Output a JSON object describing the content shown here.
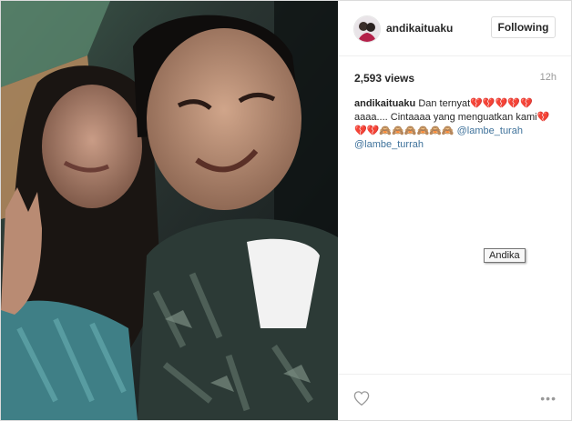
{
  "post": {
    "username": "andikaituaku",
    "follow_label": "Following",
    "views": "2,593 views",
    "time": "12h",
    "caption": {
      "username": "andikaituaku",
      "line1": "Dan ternyat💔💔💔💔💔",
      "line2": "aaaa.... Cintaaaa yang menguatkan kami💔",
      "line3_emoji": "💔💔🙈🙈🙈🙈🙈🙈",
      "mention1": "@lambe_turah",
      "mention2": "@lambe_turrah"
    },
    "tooltip": "Andika",
    "more_label": "•••"
  },
  "icons": {
    "like": "heart-icon",
    "options": "more-options-icon",
    "avatar": "avatar"
  },
  "colors": {
    "mention": "#3f729b",
    "border": "#dbdbdb",
    "muted": "#999999"
  }
}
